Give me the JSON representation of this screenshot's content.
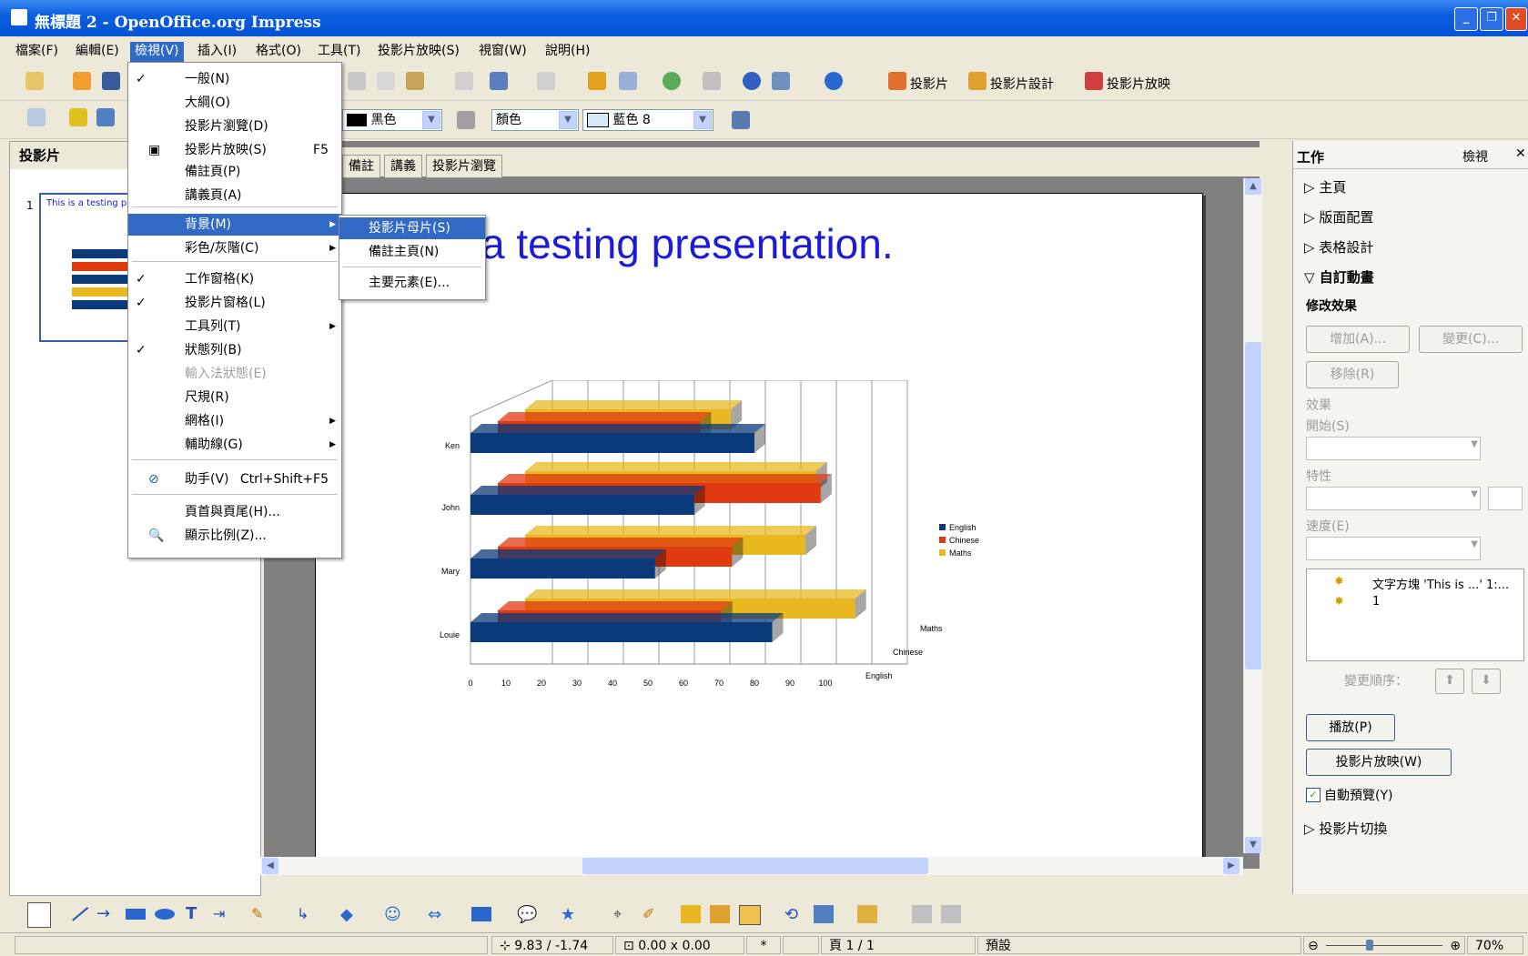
{
  "window": {
    "title": "無標題 2 - OpenOffice.org Impress"
  },
  "menubar": [
    "檔案(F)",
    "編輯(E)",
    "檢視(V)",
    "插入(I)",
    "格式(O)",
    "工具(T)",
    "投影片放映(S)",
    "視窗(W)",
    "說明(H)"
  ],
  "toolbar1": {
    "slide": "投影片",
    "slide_design": "投影片設計",
    "slide_show": "投影片放映"
  },
  "toolbar2": {
    "line_color": "黑色",
    "area_style": "顏色",
    "area_color": "藍色 8"
  },
  "slides_panel": {
    "title": "投影片",
    "thumb_number": "1",
    "thumb_text": "This is a testing pre"
  },
  "view_tabs": [
    "備註",
    "講義",
    "投影片瀏覽"
  ],
  "slide": {
    "title": "a testing presentation."
  },
  "view_menu": {
    "items": [
      {
        "label": "一般(N)",
        "check": true
      },
      {
        "label": "大綱(O)"
      },
      {
        "label": "投影片瀏覽(D)"
      },
      {
        "label": "投影片放映(S)",
        "accel": "F5",
        "icon": true
      },
      {
        "label": "備註頁(P)"
      },
      {
        "label": "講義頁(A)"
      },
      {
        "label": "背景(M)",
        "submenu": true,
        "highlight": true
      },
      {
        "label": "彩色/灰階(C)",
        "submenu": true
      },
      {
        "label": "工作窗格(K)",
        "check": true
      },
      {
        "label": "投影片窗格(L)",
        "check": true
      },
      {
        "label": "工具列(T)",
        "submenu": true
      },
      {
        "label": "狀態列(B)",
        "check": true
      },
      {
        "label": "輸入法狀態(E)",
        "disabled": true
      },
      {
        "label": "尺規(R)"
      },
      {
        "label": "網格(I)",
        "submenu": true
      },
      {
        "label": "輔助線(G)",
        "submenu": true
      },
      {
        "label": "助手(V)",
        "accel": "Ctrl+Shift+F5"
      },
      {
        "label": "頁首與頁尾(H)..."
      },
      {
        "label": "顯示比例(Z)..."
      }
    ]
  },
  "bg_submenu": [
    "投影片母片(S)",
    "備註主頁(N)",
    "主要元素(E)..."
  ],
  "taskpane": {
    "title": "工作",
    "view": "檢視",
    "sections": [
      "主頁",
      "版面配置",
      "表格設計",
      "自訂動畫"
    ],
    "modify": "修改效果",
    "add": "增加(A)...",
    "change": "變更(C)...",
    "remove": "移除(R)",
    "effect": "效果",
    "start": "開始(S)",
    "property": "特性",
    "speed": "速度(E)",
    "list": [
      "文字方塊 'This is ...' 1:...",
      "1"
    ],
    "reorder": "變更順序：",
    "play": "播放(P)",
    "slideshow": "投影片放映(W)",
    "autopreview": "自動預覽(Y)",
    "transition": "投影片切換"
  },
  "statusbar": {
    "position": "9.83 / -1.74",
    "size": "0.00 x 0.00",
    "modified": "*",
    "page": "頁 1 / 1",
    "layout": "預設",
    "zoom": "70%"
  },
  "chart_data": {
    "type": "bar",
    "orientation": "horizontal-3d",
    "categories": [
      "Ken",
      "John",
      "Mary",
      "Louie"
    ],
    "series": [
      {
        "name": "English",
        "color": "#0b3a7a",
        "values": [
          80,
          63,
          52,
          85
        ]
      },
      {
        "name": "Chinese",
        "color": "#e03a10",
        "values": [
          57,
          91,
          66,
          63
        ]
      },
      {
        "name": "Maths",
        "color": "#e8b820",
        "values": [
          58,
          82,
          79,
          93
        ]
      }
    ],
    "xticks": [
      "0",
      "10",
      "20",
      "30",
      "40",
      "50",
      "60",
      "70",
      "80",
      "90",
      "100"
    ],
    "xlim": [
      0,
      100
    ],
    "depth_labels": [
      "Maths",
      "Chinese",
      "English"
    ],
    "legend": "right"
  }
}
